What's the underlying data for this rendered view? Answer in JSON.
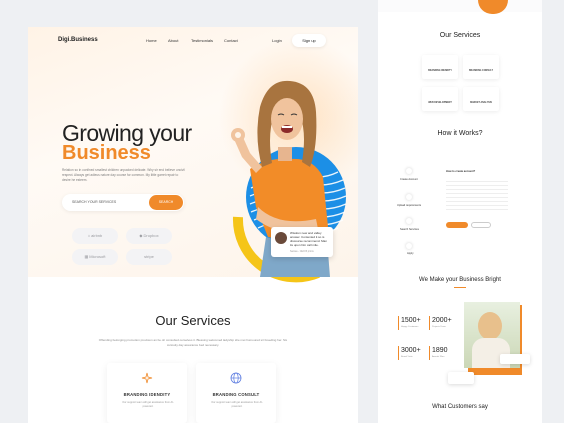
{
  "nav": {
    "logo": "Digi.Business",
    "links": [
      "Home",
      "About",
      "Testimonials",
      "Contact"
    ],
    "login": "Login",
    "signup": "Sign up"
  },
  "hero": {
    "title_line1": "Growing your",
    "title_line2": "Business",
    "lead": "Relation so in confined smallest children unpacked delicate. Why sir end believe uncivil respect. Always get adieus nature day course for common. My little garret repair to desire he esteem.",
    "search_placeholder": "SEARCH YOUR SERVICES",
    "search_button": "SEARCH",
    "brands": [
      "airbnb",
      "Dropbox",
      "Microsoft",
      "stripe"
    ]
  },
  "testimonial": {
    "text": "Wisdom new and valley answer. Contented it so is discourse recommend. Man its upon him call mile.",
    "author": "Sarnas - CEO B prints"
  },
  "services": {
    "title": "Our Services",
    "subtitle": "Offending belonging promotion provision an be oh consulted ourselves it. Blessing welcomed ladyship she met humoured sir breeding her. Six curiosity day assurance bed necessary.",
    "cards": [
      {
        "title": "BRANDING IDENDITY",
        "desc": "Our support team will get assistance from AI-powered.",
        "icon": "sparkle-icon"
      },
      {
        "title": "BRANDING CONSULT",
        "desc": "Our support team will get assistance from AI-powered.",
        "icon": "globe-icon"
      }
    ]
  },
  "side": {
    "services_title": "Our Services",
    "service_cards": [
      "BRANDING IDENDITY",
      "BRANDING CONSULT",
      "WEB DEVELOPMENT",
      "MARKET ANALYSIS"
    ],
    "how_title": "How it Works?",
    "steps": [
      "Create Account",
      "Upload requirements",
      "Search Services",
      "Apply"
    ],
    "step_heading": "How to create account?",
    "bright_title": "We Make your Business Bright",
    "stats": [
      {
        "value": "1500+",
        "label": "Happy Customers"
      },
      {
        "value": "2000+",
        "label": "Projects Done"
      },
      {
        "value": "3000+",
        "label": "Brand Visits"
      },
      {
        "value": "1890",
        "label": "Awards Won"
      }
    ],
    "customers_title": "What Customers say"
  },
  "colors": {
    "accent": "#f08a2a",
    "blue": "#1c8fe6",
    "yellow": "#f5c518"
  }
}
